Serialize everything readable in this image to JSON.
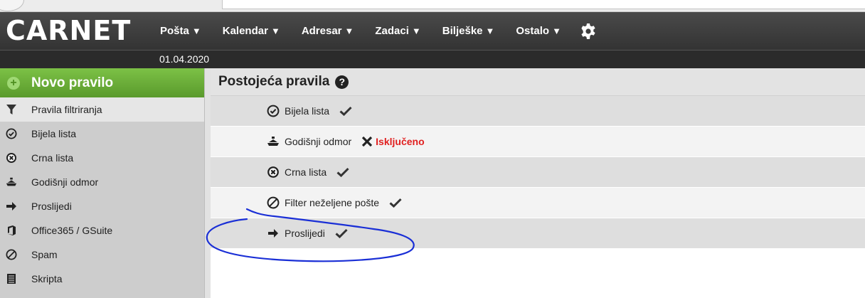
{
  "app": {
    "logo": "CARNET",
    "date": "01.04.2020"
  },
  "nav": {
    "items": [
      {
        "label": "Pošta",
        "icon": "caret-down-icon"
      },
      {
        "label": "Kalendar",
        "icon": "caret-down-icon"
      },
      {
        "label": "Adresar",
        "icon": "caret-down-icon"
      },
      {
        "label": "Zadaci",
        "icon": "caret-down-icon"
      },
      {
        "label": "Bilješke",
        "icon": "caret-down-icon"
      },
      {
        "label": "Ostalo",
        "icon": "caret-down-icon"
      }
    ],
    "settings_icon": "gear-icon"
  },
  "sidebar": {
    "new_rule_label": "Novo pravilo",
    "items": [
      {
        "label": "Pravila filtriranja",
        "icon": "filter-icon",
        "active": true
      },
      {
        "label": "Bijela lista",
        "icon": "check-circle-icon"
      },
      {
        "label": "Crna lista",
        "icon": "x-circle-icon"
      },
      {
        "label": "Godišnji odmor",
        "icon": "ship-icon"
      },
      {
        "label": "Proslijedi",
        "icon": "arrow-right-icon"
      },
      {
        "label": "Office365 / GSuite",
        "icon": "office-icon"
      },
      {
        "label": "Spam",
        "icon": "no-entry-icon"
      },
      {
        "label": "Skripta",
        "icon": "script-icon"
      }
    ]
  },
  "main": {
    "title": "Postojeća pravila",
    "rules": [
      {
        "name": "Bijela lista",
        "icon": "check-circle-icon",
        "enabled": true
      },
      {
        "name": "Godišnji odmor",
        "icon": "ship-icon",
        "enabled": false,
        "status_text": "Isključeno"
      },
      {
        "name": "Crna lista",
        "icon": "x-circle-icon",
        "enabled": true
      },
      {
        "name": "Filter neželjene pošte",
        "icon": "no-entry-icon",
        "enabled": true
      },
      {
        "name": "Proslijedi",
        "icon": "arrow-right-icon",
        "enabled": true
      }
    ]
  },
  "colors": {
    "topbar": "#3a3a3a",
    "new_rule_green": "#6aad37",
    "disabled_red": "#e02020",
    "annotation_blue": "#1a2fd6"
  }
}
